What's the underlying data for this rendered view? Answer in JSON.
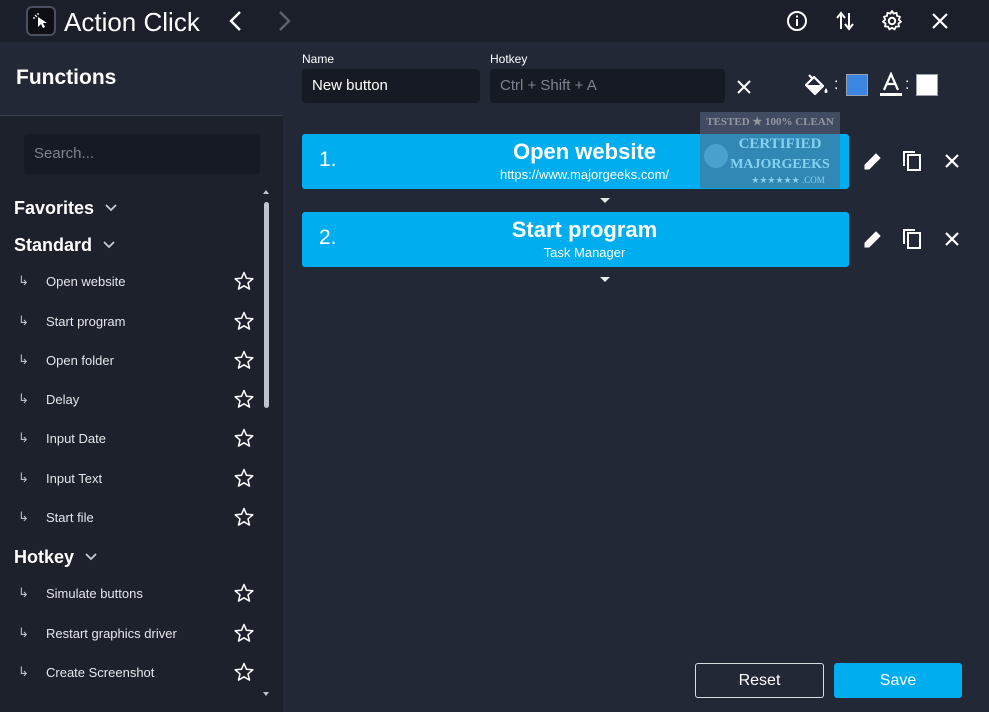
{
  "app": {
    "title": "Action Click"
  },
  "titlebar": {
    "icons": [
      "back-icon",
      "forward-icon",
      "info-icon",
      "sort-icon",
      "gear-icon",
      "close-icon"
    ]
  },
  "sidebar": {
    "title": "Functions",
    "search_placeholder": "Search...",
    "categories": [
      {
        "label": "Favorites",
        "items": []
      },
      {
        "label": "Standard",
        "items": [
          {
            "label": "Open website"
          },
          {
            "label": "Start program"
          },
          {
            "label": "Open folder"
          },
          {
            "label": "Delay"
          },
          {
            "label": "Input Date"
          },
          {
            "label": "Input Text"
          },
          {
            "label": "Start file"
          }
        ]
      },
      {
        "label": "Hotkey",
        "items": [
          {
            "label": "Simulate buttons"
          },
          {
            "label": "Restart graphics driver"
          },
          {
            "label": "Create Screenshot"
          }
        ]
      }
    ],
    "item_arrow": "↳"
  },
  "editor": {
    "name_label": "Name",
    "name_value": "New button",
    "hotkey_label": "Hotkey",
    "hotkey_placeholder": "Ctrl + Shift + A",
    "colon": ":",
    "background_color": "#3a86e0",
    "text_color": "#ffffff"
  },
  "actions": [
    {
      "number": "1.",
      "title": "Open website",
      "subtitle": "https://www.majorgeeks.com/"
    },
    {
      "number": "2.",
      "title": "Start program",
      "subtitle": "Task Manager"
    }
  ],
  "footer": {
    "reset_label": "Reset",
    "save_label": "Save"
  },
  "colors": {
    "accent": "#00aef0",
    "background": "#232836",
    "sidebar": "#1d212c",
    "input": "#161a22"
  },
  "watermark": {
    "line1": "TESTED ★ 100% CLEAN",
    "line2": "CERTIFIED",
    "line3": "MAJORGEEKS",
    "line4": "★★★★★★ .COM"
  }
}
